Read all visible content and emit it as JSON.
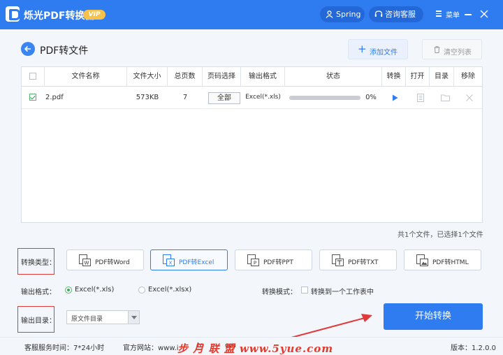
{
  "app": {
    "title": "烁光PDF转换器",
    "vip": "VIP"
  },
  "header": {
    "user": "Spring",
    "service": "咨询客服",
    "menu": "菜单"
  },
  "page": {
    "title": "PDF转文件",
    "add_file": "添加文件",
    "clear_list": "清空列表"
  },
  "table": {
    "headers": [
      "文件名称",
      "文件大小",
      "总页数",
      "页码选择",
      "输出格式",
      "状态",
      "转换",
      "打开",
      "目录",
      "移除"
    ],
    "rows": [
      {
        "name": "2.pdf",
        "size": "573KB",
        "pages": "7",
        "range": "全部",
        "format": "Excel(*.xls)",
        "progress": 0,
        "progress_text": "0%",
        "checked": true
      }
    ]
  },
  "file_count": "共1个文件，已选择1个文件",
  "convert_type": {
    "label": "转换类型：",
    "options": [
      "PDF转Word",
      "PDF转Excel",
      "PDF转PPT",
      "PDF转TXT",
      "PDF转HTML"
    ],
    "selected": "PDF转Excel"
  },
  "output_format": {
    "label": "输出格式：",
    "options": [
      "Excel(*.xls)",
      "Excel(*.xlsx)"
    ],
    "selected": "Excel(*.xls)"
  },
  "convert_mode": {
    "label": "转换模式：",
    "option": "转换到一个工作表中"
  },
  "output_dir": {
    "label": "输出目录：",
    "value": "原文件目录"
  },
  "start_button": "开始转换",
  "footer": {
    "service_hours": "客服服务时间：7*24小时",
    "website": "官方网站：www.i",
    "website_tail": "to",
    "website_tail2": "om",
    "version": "版本：1.2.0.0"
  },
  "watermark": "步 月 联 盟   www.5yue.com",
  "colors": {
    "primary": "#2f7bf0",
    "vip": "#f7c24a",
    "highlight": "#e03a3a"
  }
}
